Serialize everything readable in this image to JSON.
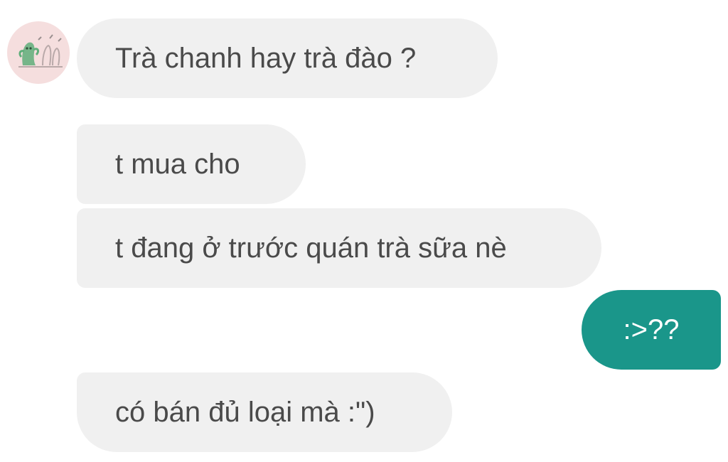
{
  "contact": {
    "avatar_icon": "cactus-doodle-avatar"
  },
  "messages": [
    {
      "direction": "incoming",
      "text": "Trà chanh hay trà đào ?"
    },
    {
      "direction": "incoming",
      "text": "t mua cho"
    },
    {
      "direction": "incoming",
      "text": "t đang ở trước quán trà sữa nè"
    },
    {
      "direction": "outgoing",
      "text": ":>??"
    },
    {
      "direction": "incoming",
      "text": "có bán đủ loại mà :\")"
    }
  ],
  "colors": {
    "incoming_bubble": "#f0f0f0",
    "incoming_text": "#4a4a4a",
    "outgoing_bubble": "#1a968a",
    "outgoing_text": "#ffffff",
    "avatar_background": "#f5dede"
  }
}
